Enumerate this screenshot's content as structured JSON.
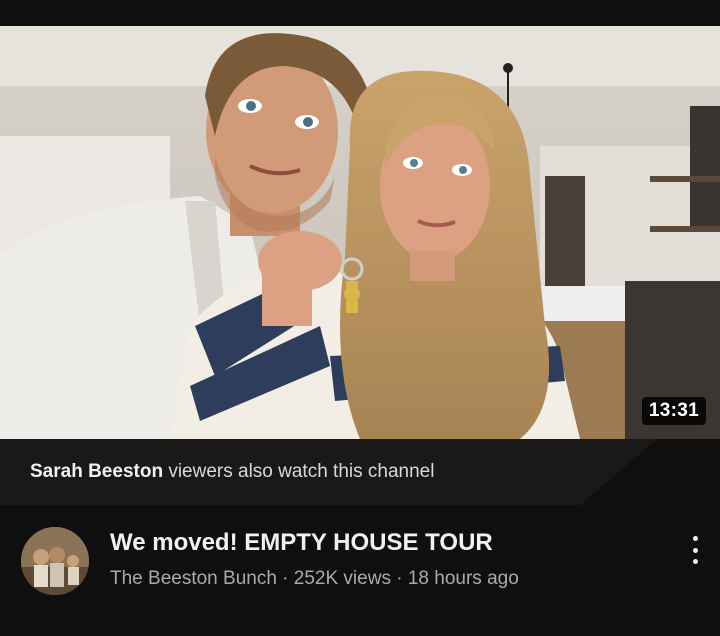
{
  "video": {
    "duration": "13:31",
    "title": "We moved! EMPTY HOUSE TOUR",
    "channel": "The Beeston Bunch",
    "separator": " · ",
    "views": "252K views",
    "age": "18 hours ago"
  },
  "shelf": {
    "channel_name": "Sarah Beeston",
    "suffix": " viewers also watch this channel"
  },
  "icons": {
    "menu": "more-vert-icon"
  },
  "colors": {
    "background": "#0f0f0f",
    "shelf_background": "#191919",
    "primary_text": "#f1f1f1",
    "secondary_text": "#aaaaaa"
  }
}
